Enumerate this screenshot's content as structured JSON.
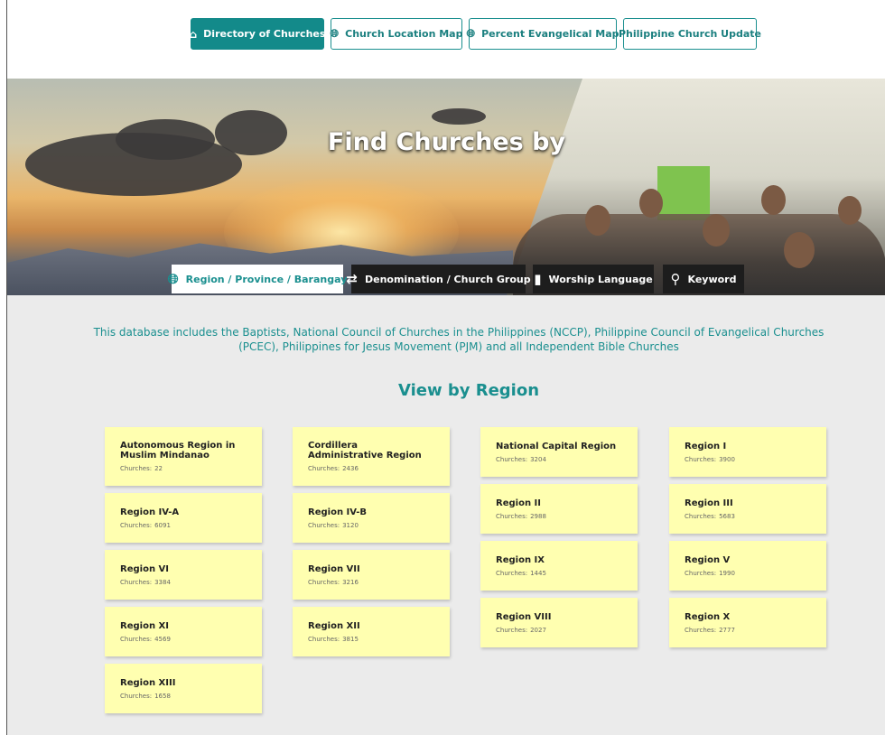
{
  "nav": {
    "items": [
      {
        "label": "Directory of Churches",
        "icon": "house-icon",
        "active": true
      },
      {
        "label": "Church Location Map",
        "icon": "globe-icon",
        "active": false
      },
      {
        "label": "Percent Evangelical Map",
        "icon": "globe-icon",
        "active": false
      },
      {
        "label": "Philippine Church Update",
        "icon": "",
        "active": false
      }
    ]
  },
  "hero": {
    "title": "Find Churches by",
    "tabs": [
      {
        "label": "Region / Province / Barangay",
        "icon": "globe-icon",
        "active": true
      },
      {
        "label": "Denomination / Church Group",
        "icon": "shuffle-icon",
        "active": false
      },
      {
        "label": "Worship Language",
        "icon": "speech-bubble-icon",
        "active": false
      },
      {
        "label": "Keyword",
        "icon": "search-icon",
        "active": false
      }
    ]
  },
  "intro": "This database includes the Baptists, National Council of Churches in the Philippines (NCCP), Philippine Council of Evangelical Churches (PCEC), Philippines for Jesus Movement (PJM) and all Independent Bible Churches",
  "section_title": "View by Region",
  "count_label": "Churches:",
  "regions": [
    {
      "name": "Autonomous Region in Muslim Mindanao",
      "count": "22"
    },
    {
      "name": "Cordillera Administrative Region",
      "count": "2436"
    },
    {
      "name": "National Capital Region",
      "count": "3204"
    },
    {
      "name": "Region I",
      "count": "3900"
    },
    {
      "name": "Region IV-A",
      "count": "6091"
    },
    {
      "name": "Region IV-B",
      "count": "3120"
    },
    {
      "name": "Region II",
      "count": "2988"
    },
    {
      "name": "Region III",
      "count": "5683"
    },
    {
      "name": "Region VI",
      "count": "3384"
    },
    {
      "name": "Region VII",
      "count": "3216"
    },
    {
      "name": "Region IX",
      "count": "1445"
    },
    {
      "name": "Region V",
      "count": "1990"
    },
    {
      "name": "Region XI",
      "count": "4569"
    },
    {
      "name": "Region XII",
      "count": "3815"
    },
    {
      "name": "Region VIII",
      "count": "2027"
    },
    {
      "name": "Region X",
      "count": "2777"
    },
    {
      "name": "Region XIII",
      "count": "1658"
    }
  ],
  "colors": {
    "accent": "#138a8a",
    "card": "#ffffb0",
    "tab_dark": "#1d1d1d"
  }
}
